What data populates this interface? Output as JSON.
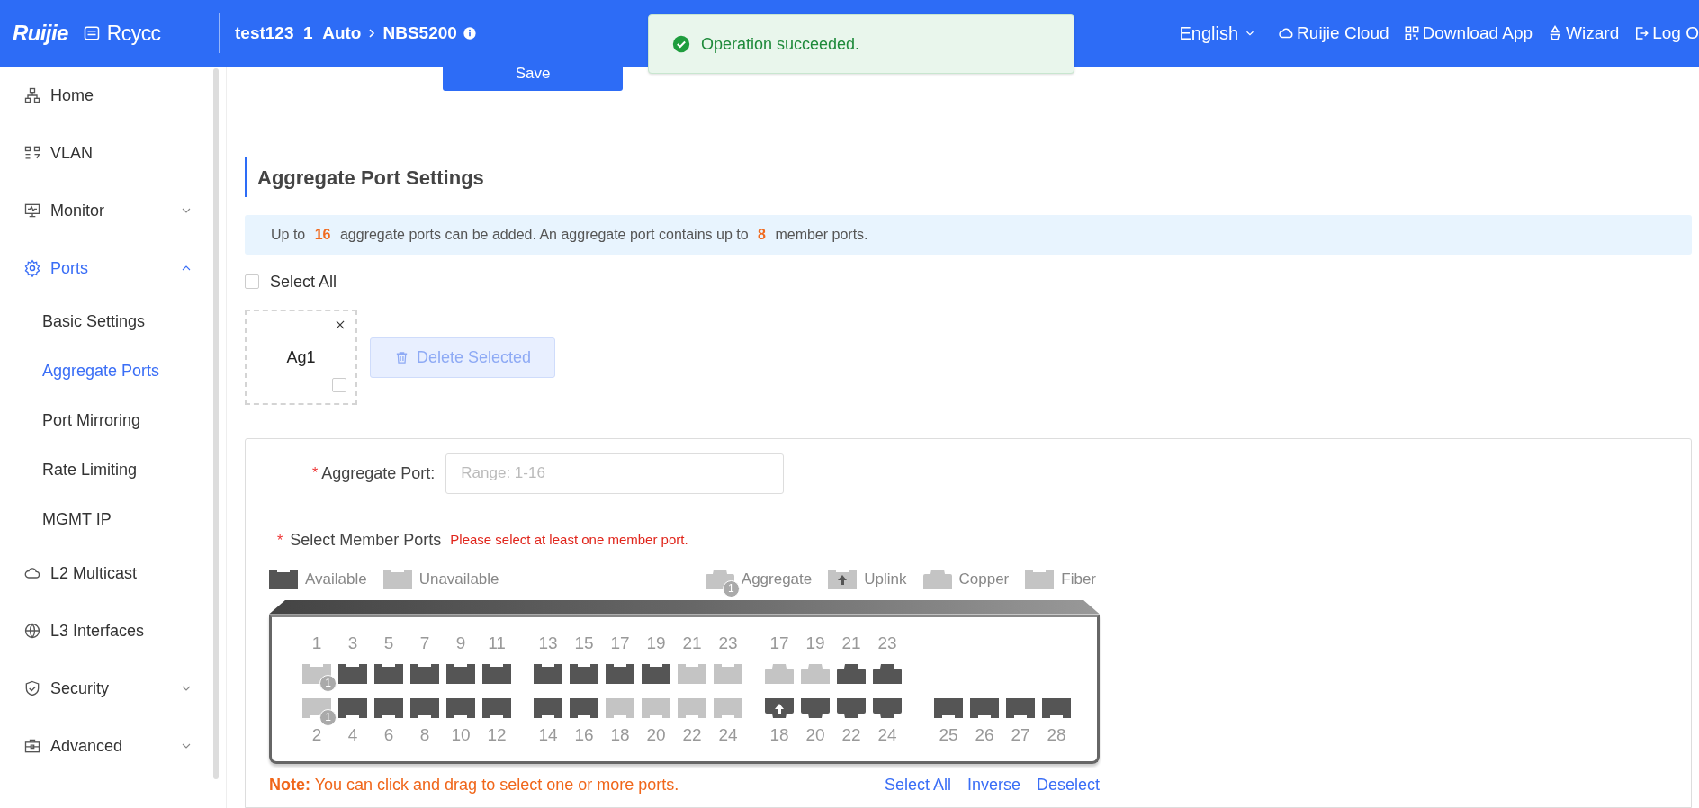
{
  "header": {
    "logo": "Ruijie",
    "logo_sub": "Rcycc",
    "breadcrumb": [
      "test123_1_Auto",
      "NBS5200"
    ],
    "language": "English",
    "links": [
      {
        "label": "Ruijie Cloud"
      },
      {
        "label": "Download App"
      },
      {
        "label": "Wizard"
      },
      {
        "label": "Log O"
      }
    ]
  },
  "toast": {
    "message": "Operation succeeded."
  },
  "sidebar": {
    "items": [
      {
        "label": "Home",
        "selected": false
      },
      {
        "label": "VLAN",
        "selected": false
      },
      {
        "label": "Monitor",
        "selected": false,
        "expanded": false
      },
      {
        "label": "Ports",
        "selected": true,
        "expanded": true,
        "children": [
          {
            "label": "Basic Settings",
            "selected": false
          },
          {
            "label": "Aggregate Ports",
            "selected": true
          },
          {
            "label": "Port Mirroring",
            "selected": false
          },
          {
            "label": "Rate Limiting",
            "selected": false
          },
          {
            "label": "MGMT IP",
            "selected": false
          }
        ]
      },
      {
        "label": "L2 Multicast",
        "selected": false
      },
      {
        "label": "L3 Interfaces",
        "selected": false
      },
      {
        "label": "Security",
        "selected": false,
        "expanded": false
      },
      {
        "label": "Advanced",
        "selected": false,
        "expanded": false
      }
    ]
  },
  "save_button": "Save",
  "section": {
    "title": "Aggregate Port Settings",
    "info": "Up to **16** aggregate ports can be added. An aggregate port contains up to **8** member ports.",
    "select_all": {
      "label": "Select All",
      "checked": false
    },
    "aggregate_cards": [
      {
        "label": "Ag1",
        "checked": false
      }
    ],
    "delete_button": {
      "label": "Delete Selected",
      "disabled": true
    }
  },
  "form": {
    "aggregate_port": {
      "required_mark": "*",
      "label": "Aggregate Port:",
      "placeholder": "Range: 1-16"
    },
    "member_ports": {
      "required_mark": "*",
      "label": "Select Member Ports",
      "error": "Please select at least one member port."
    },
    "legend": [
      {
        "kind": "available",
        "label": "Available"
      },
      {
        "kind": "unavailable",
        "label": "Unavailable"
      },
      {
        "kind": "aggregate",
        "label": "Aggregate",
        "badge": "1"
      },
      {
        "kind": "uplink",
        "label": "Uplink"
      },
      {
        "kind": "copper",
        "label": "Copper"
      },
      {
        "kind": "fiber",
        "label": "Fiber"
      }
    ],
    "groups": [
      {
        "columns": [
          {
            "top": {
              "number": "1",
              "kind": "fiber",
              "available": false,
              "badge": "1"
            },
            "bottom": {
              "number": "2",
              "kind": "fiber",
              "available": false,
              "badge": "1"
            }
          },
          {
            "top": {
              "number": "3",
              "kind": "fiber",
              "available": true
            },
            "bottom": {
              "number": "4",
              "kind": "fiber",
              "available": true
            }
          },
          {
            "top": {
              "number": "5",
              "kind": "fiber",
              "available": true
            },
            "bottom": {
              "number": "6",
              "kind": "fiber",
              "available": true
            }
          },
          {
            "top": {
              "number": "7",
              "kind": "fiber",
              "available": true
            },
            "bottom": {
              "number": "8",
              "kind": "fiber",
              "available": true
            }
          },
          {
            "top": {
              "number": "9",
              "kind": "fiber",
              "available": true
            },
            "bottom": {
              "number": "10",
              "kind": "fiber",
              "available": true
            }
          },
          {
            "top": {
              "number": "11",
              "kind": "fiber",
              "available": true
            },
            "bottom": {
              "number": "12",
              "kind": "fiber",
              "available": true
            }
          }
        ]
      },
      {
        "columns": [
          {
            "top": {
              "number": "13",
              "kind": "fiber",
              "available": true
            },
            "bottom": {
              "number": "14",
              "kind": "fiber",
              "available": true
            }
          },
          {
            "top": {
              "number": "15",
              "kind": "fiber",
              "available": true
            },
            "bottom": {
              "number": "16",
              "kind": "fiber",
              "available": true
            }
          },
          {
            "top": {
              "number": "17",
              "kind": "fiber",
              "available": true
            },
            "bottom": {
              "number": "18",
              "kind": "fiber",
              "available": false
            }
          },
          {
            "top": {
              "number": "19",
              "kind": "fiber",
              "available": true
            },
            "bottom": {
              "number": "20",
              "kind": "fiber",
              "available": false
            }
          },
          {
            "top": {
              "number": "21",
              "kind": "fiber",
              "available": false
            },
            "bottom": {
              "number": "22",
              "kind": "fiber",
              "available": false
            }
          },
          {
            "top": {
              "number": "23",
              "kind": "fiber",
              "available": false
            },
            "bottom": {
              "number": "24",
              "kind": "fiber",
              "available": false
            }
          }
        ]
      },
      {
        "columns": [
          {
            "top": {
              "number": "17",
              "kind": "copper",
              "available": false
            },
            "bottom": {
              "number": "18",
              "kind": "copper",
              "available": true,
              "uplink": true
            }
          },
          {
            "top": {
              "number": "19",
              "kind": "copper",
              "available": false
            },
            "bottom": {
              "number": "20",
              "kind": "copper",
              "available": true
            }
          },
          {
            "top": {
              "number": "21",
              "kind": "copper",
              "available": true
            },
            "bottom": {
              "number": "22",
              "kind": "copper",
              "available": true
            }
          },
          {
            "top": {
              "number": "23",
              "kind": "copper",
              "available": true
            },
            "bottom": {
              "number": "24",
              "kind": "copper",
              "available": true
            }
          }
        ]
      },
      {
        "columns": [
          {
            "bottom": {
              "number": "25",
              "kind": "fiber",
              "available": true
            }
          },
          {
            "bottom": {
              "number": "26",
              "kind": "fiber",
              "available": true
            }
          },
          {
            "bottom": {
              "number": "27",
              "kind": "fiber",
              "available": true
            }
          },
          {
            "bottom": {
              "number": "28",
              "kind": "fiber",
              "available": true
            }
          }
        ]
      }
    ],
    "note": "**Note:** You can click and drag to select one or more ports.",
    "actions": [
      "Select All",
      "Inverse",
      "Deselect"
    ]
  }
}
